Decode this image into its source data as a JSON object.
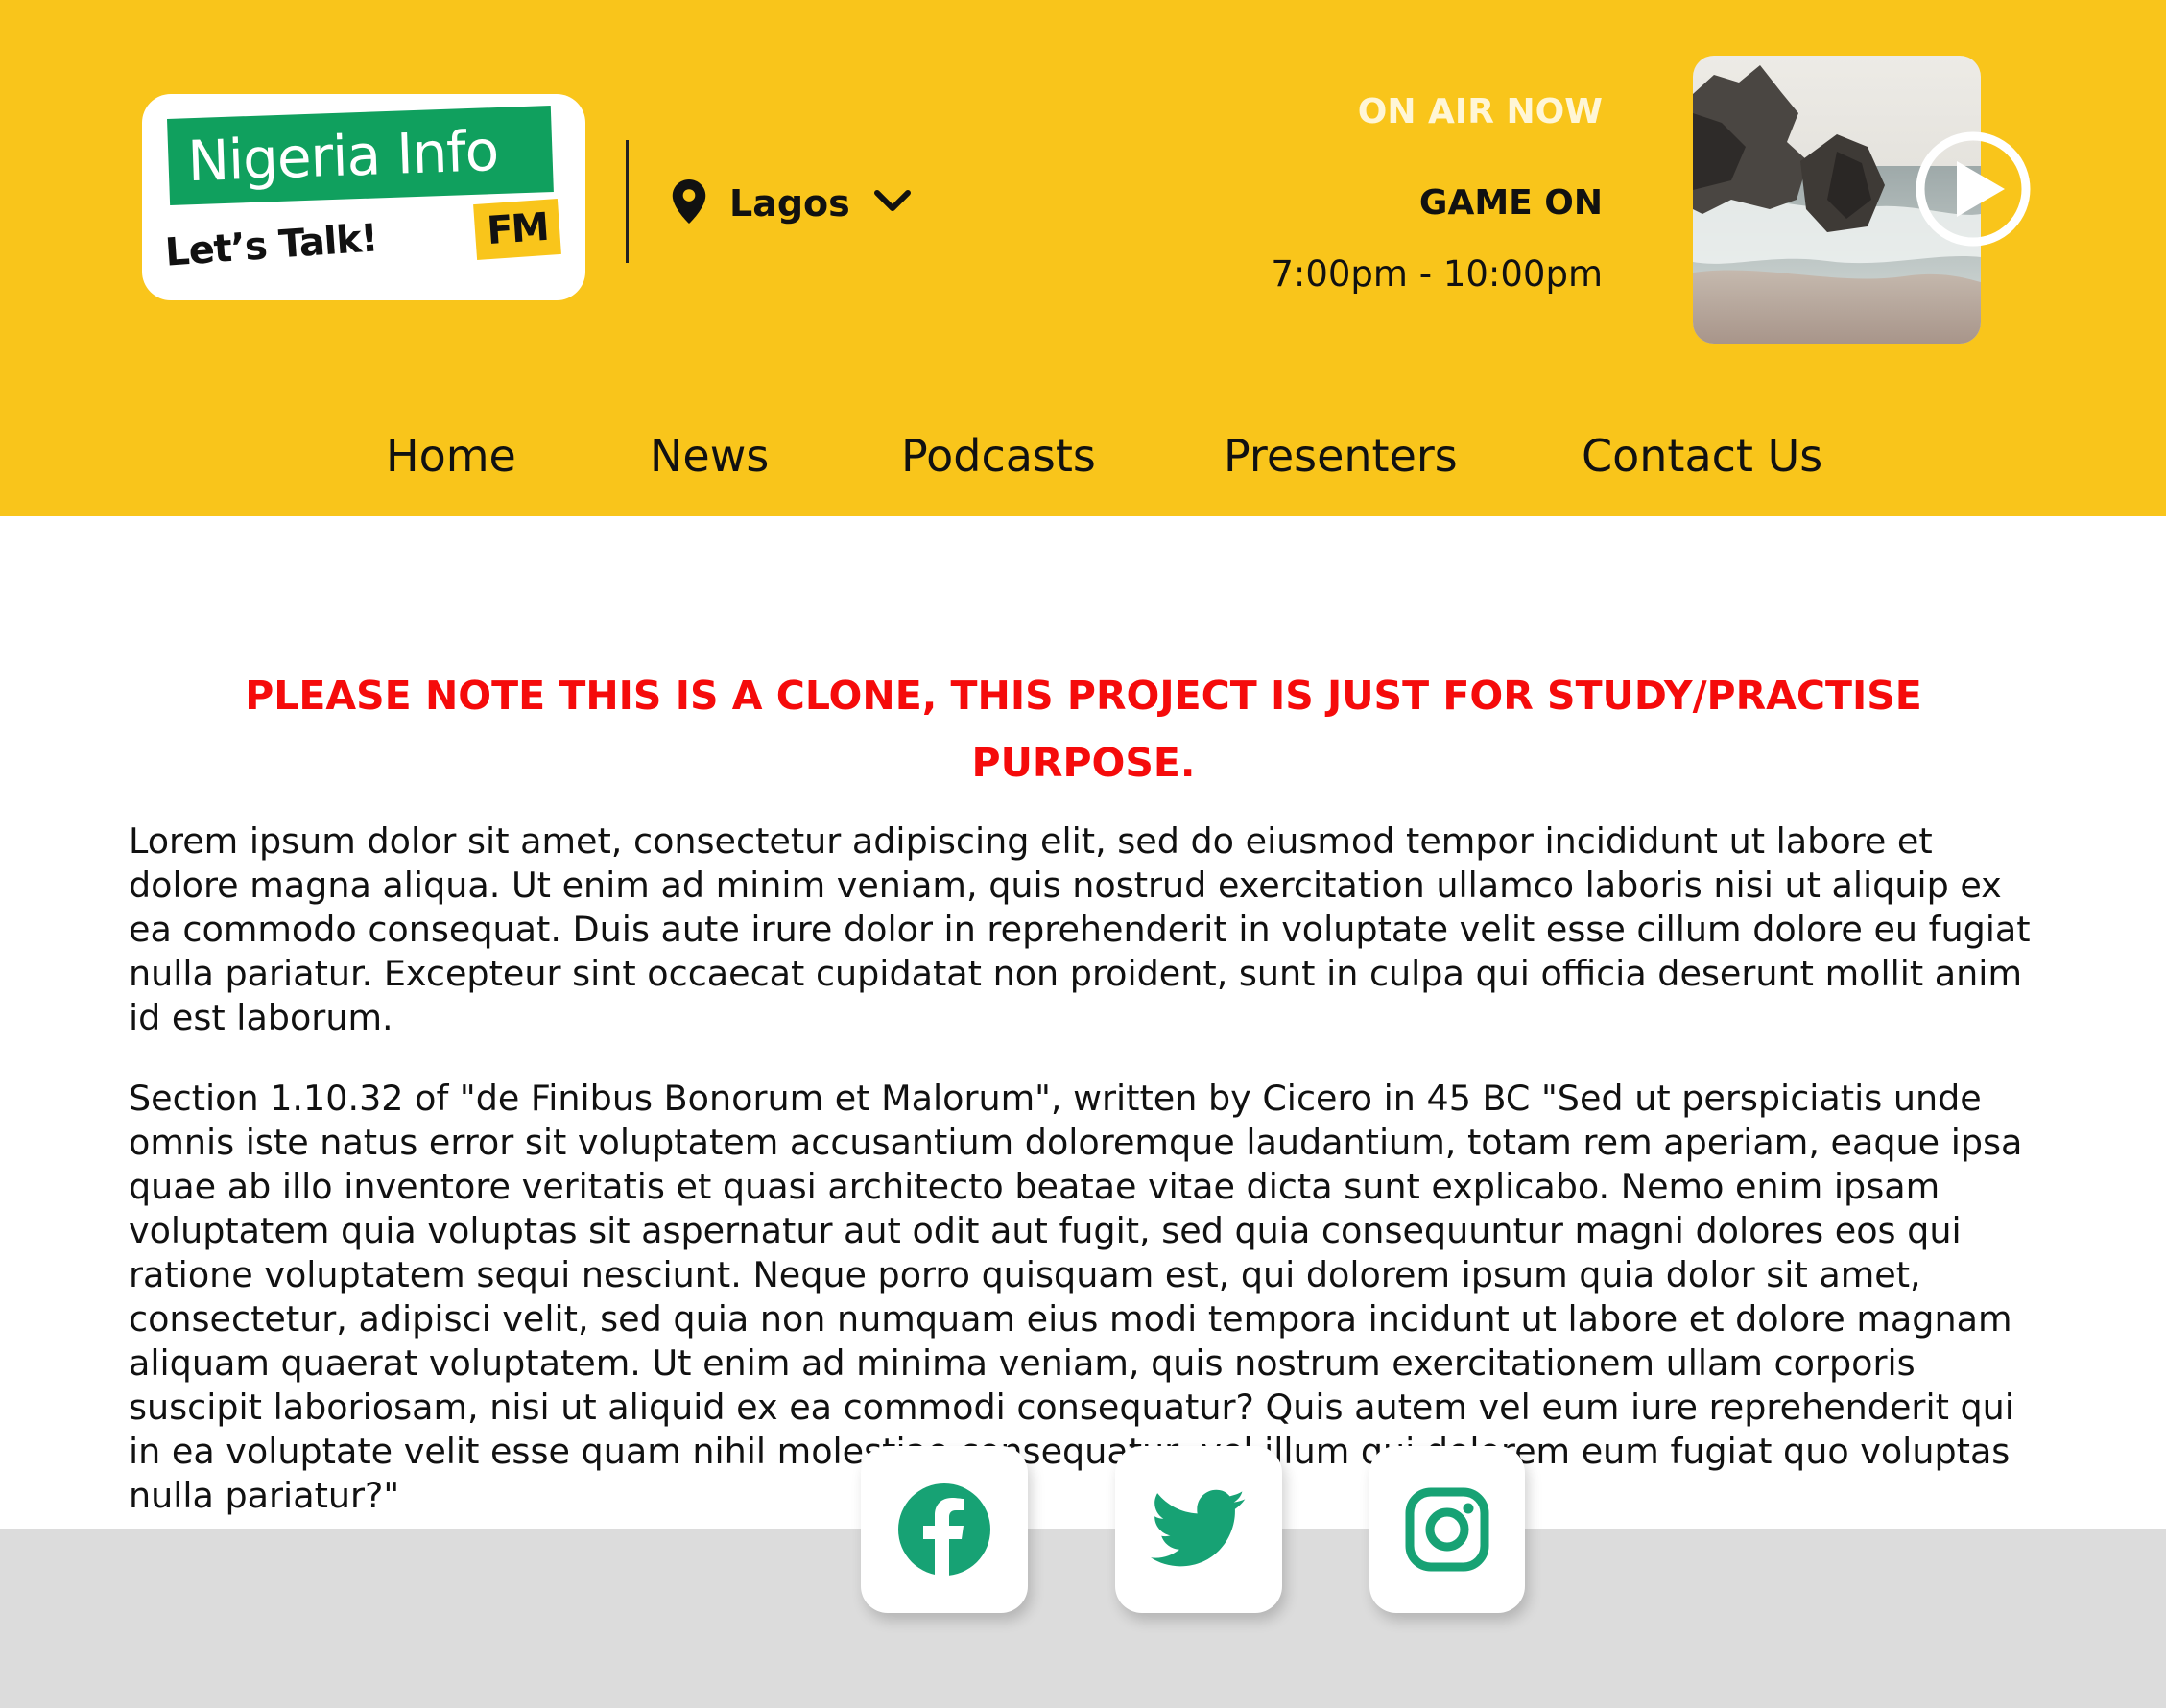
{
  "colors": {
    "header_bg": "#F9C51B",
    "brand_green": "#10A05E",
    "notice_red": "#F50B0B",
    "footer_bg": "#DCDCDC",
    "social_icon": "#17A274"
  },
  "logo": {
    "title": "Nigeria Info",
    "tagline": "Let’s Talk!",
    "badge": "FM"
  },
  "location": {
    "icon": "map-pin-icon",
    "label": "Lagos",
    "dropdown_icon": "chevron-down-icon"
  },
  "on_air": {
    "label": "ON AIR NOW",
    "show_name": "GAME ON",
    "time": "7:00pm - 10:00pm",
    "play_icon": "play-circle-icon"
  },
  "nav": {
    "items": [
      {
        "label": "Home"
      },
      {
        "label": "News"
      },
      {
        "label": "Podcasts"
      },
      {
        "label": "Presenters"
      },
      {
        "label": "Contact Us"
      }
    ]
  },
  "main": {
    "notice": "PLEASE NOTE THIS IS A CLONE, THIS PROJECT IS JUST FOR STUDY/PRACTISE PURPOSE.",
    "paragraphs": [
      "Lorem ipsum dolor sit amet, consectetur adipiscing elit, sed do eiusmod tempor incididunt ut labore et dolore magna aliqua. Ut enim ad minim veniam, quis nostrud exercitation ullamco laboris nisi ut aliquip ex ea commodo consequat. Duis aute irure dolor in reprehenderit in voluptate velit esse cillum dolore eu fugiat nulla pariatur. Excepteur sint occaecat cupidatat non proident, sunt in culpa qui officia deserunt mollit anim id est laborum.",
      "Section 1.10.32 of \"de Finibus Bonorum et Malorum\", written by Cicero in 45 BC \"Sed ut perspiciatis unde omnis iste natus error sit voluptatem accusantium doloremque laudantium, totam rem aperiam, eaque ipsa quae ab illo inventore veritatis et quasi architecto beatae vitae dicta sunt explicabo. Nemo enim ipsam voluptatem quia voluptas sit aspernatur aut odit aut fugit, sed quia consequuntur magni dolores eos qui ratione voluptatem sequi nesciunt. Neque porro quisquam est, qui dolorem ipsum quia dolor sit amet, consectetur, adipisci velit, sed quia non numquam eius modi tempora incidunt ut labore et dolore magnam aliquam quaerat voluptatem. Ut enim ad minima veniam, quis nostrum exercitationem ullam corporis suscipit laboriosam, nisi ut aliquid ex ea commodi consequatur? Quis autem vel eum iure reprehenderit qui in ea voluptate velit esse quam nihil molestiae consequatur, vel illum qui dolorem eum fugiat quo voluptas nulla pariatur?\""
    ]
  },
  "social": [
    {
      "icon": "facebook-icon"
    },
    {
      "icon": "twitter-icon"
    },
    {
      "icon": "instagram-icon"
    }
  ]
}
